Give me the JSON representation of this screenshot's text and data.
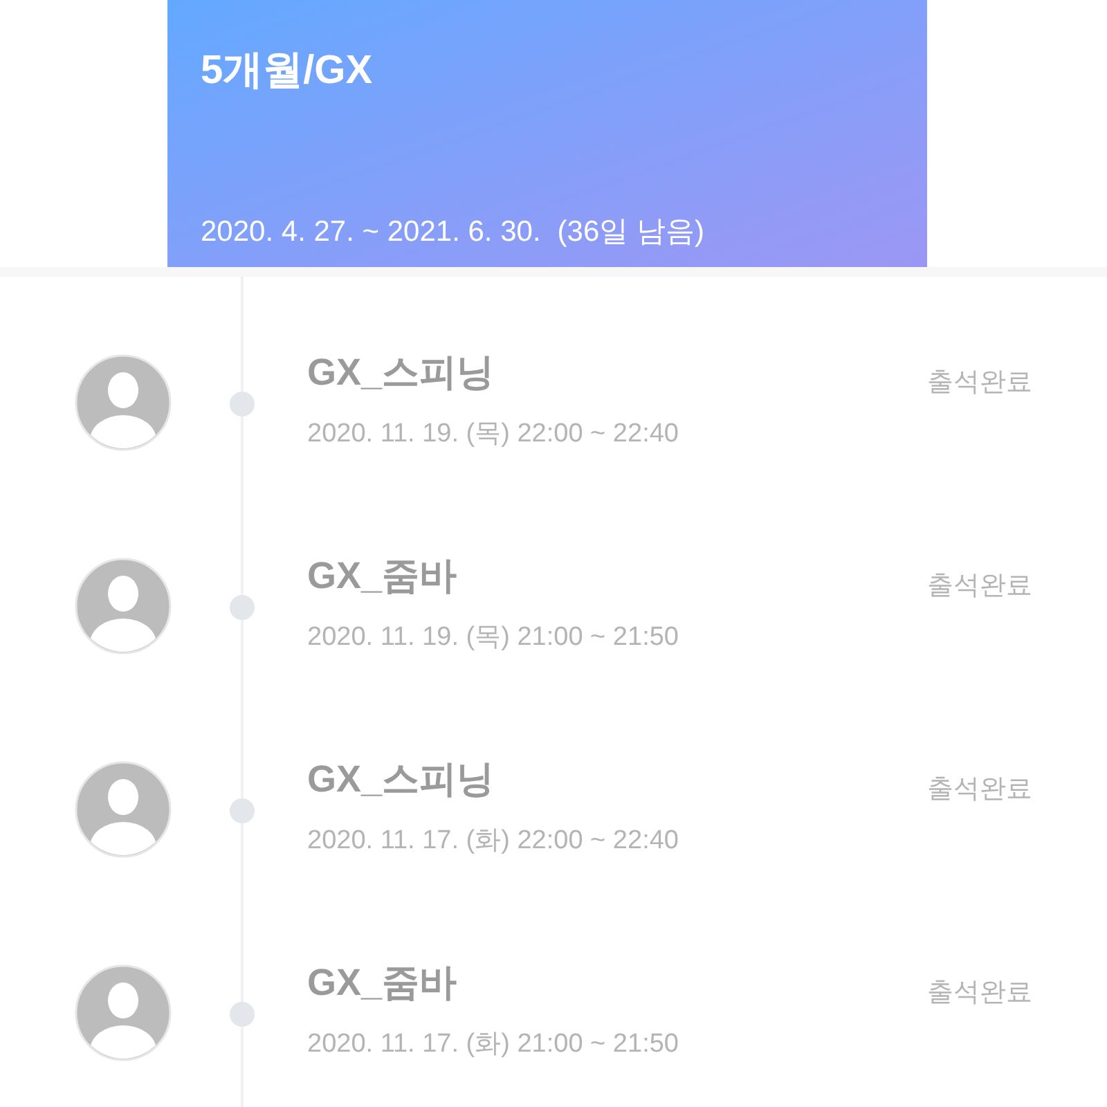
{
  "membership": {
    "title": "5개월/GX",
    "period": "2020. 4. 27. ~ 2021. 6. 30.",
    "remaining": "(36일 남음)"
  },
  "attendance": [
    {
      "class_name": "GX_스피닝",
      "datetime": "2020. 11. 19. (목) 22:00 ~ 22:40",
      "status": "출석완료"
    },
    {
      "class_name": "GX_줌바",
      "datetime": "2020. 11. 19. (목) 21:00 ~ 21:50",
      "status": "출석완료"
    },
    {
      "class_name": "GX_스피닝",
      "datetime": "2020. 11. 17. (화) 22:00 ~ 22:40",
      "status": "출석완료"
    },
    {
      "class_name": "GX_줌바",
      "datetime": "2020. 11. 17. (화) 21:00 ~ 21:50",
      "status": "출석완료"
    }
  ]
}
